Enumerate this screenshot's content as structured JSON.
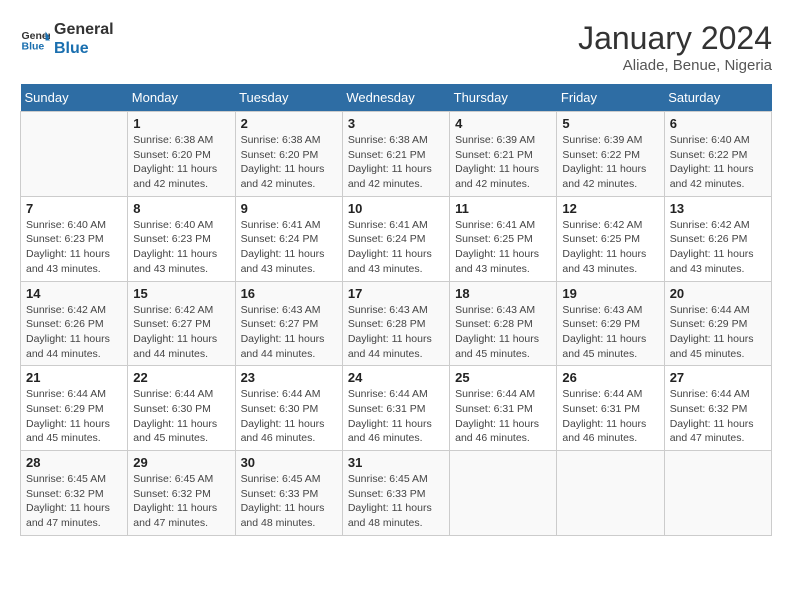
{
  "header": {
    "logo_line1": "General",
    "logo_line2": "Blue",
    "month": "January 2024",
    "location": "Aliade, Benue, Nigeria"
  },
  "days_of_week": [
    "Sunday",
    "Monday",
    "Tuesday",
    "Wednesday",
    "Thursday",
    "Friday",
    "Saturday"
  ],
  "weeks": [
    [
      {
        "day": "",
        "sunrise": "",
        "sunset": "",
        "daylight": ""
      },
      {
        "day": "1",
        "sunrise": "Sunrise: 6:38 AM",
        "sunset": "Sunset: 6:20 PM",
        "daylight": "Daylight: 11 hours and 42 minutes."
      },
      {
        "day": "2",
        "sunrise": "Sunrise: 6:38 AM",
        "sunset": "Sunset: 6:20 PM",
        "daylight": "Daylight: 11 hours and 42 minutes."
      },
      {
        "day": "3",
        "sunrise": "Sunrise: 6:38 AM",
        "sunset": "Sunset: 6:21 PM",
        "daylight": "Daylight: 11 hours and 42 minutes."
      },
      {
        "day": "4",
        "sunrise": "Sunrise: 6:39 AM",
        "sunset": "Sunset: 6:21 PM",
        "daylight": "Daylight: 11 hours and 42 minutes."
      },
      {
        "day": "5",
        "sunrise": "Sunrise: 6:39 AM",
        "sunset": "Sunset: 6:22 PM",
        "daylight": "Daylight: 11 hours and 42 minutes."
      },
      {
        "day": "6",
        "sunrise": "Sunrise: 6:40 AM",
        "sunset": "Sunset: 6:22 PM",
        "daylight": "Daylight: 11 hours and 42 minutes."
      }
    ],
    [
      {
        "day": "7",
        "sunrise": "Sunrise: 6:40 AM",
        "sunset": "Sunset: 6:23 PM",
        "daylight": "Daylight: 11 hours and 43 minutes."
      },
      {
        "day": "8",
        "sunrise": "Sunrise: 6:40 AM",
        "sunset": "Sunset: 6:23 PM",
        "daylight": "Daylight: 11 hours and 43 minutes."
      },
      {
        "day": "9",
        "sunrise": "Sunrise: 6:41 AM",
        "sunset": "Sunset: 6:24 PM",
        "daylight": "Daylight: 11 hours and 43 minutes."
      },
      {
        "day": "10",
        "sunrise": "Sunrise: 6:41 AM",
        "sunset": "Sunset: 6:24 PM",
        "daylight": "Daylight: 11 hours and 43 minutes."
      },
      {
        "day": "11",
        "sunrise": "Sunrise: 6:41 AM",
        "sunset": "Sunset: 6:25 PM",
        "daylight": "Daylight: 11 hours and 43 minutes."
      },
      {
        "day": "12",
        "sunrise": "Sunrise: 6:42 AM",
        "sunset": "Sunset: 6:25 PM",
        "daylight": "Daylight: 11 hours and 43 minutes."
      },
      {
        "day": "13",
        "sunrise": "Sunrise: 6:42 AM",
        "sunset": "Sunset: 6:26 PM",
        "daylight": "Daylight: 11 hours and 43 minutes."
      }
    ],
    [
      {
        "day": "14",
        "sunrise": "Sunrise: 6:42 AM",
        "sunset": "Sunset: 6:26 PM",
        "daylight": "Daylight: 11 hours and 44 minutes."
      },
      {
        "day": "15",
        "sunrise": "Sunrise: 6:42 AM",
        "sunset": "Sunset: 6:27 PM",
        "daylight": "Daylight: 11 hours and 44 minutes."
      },
      {
        "day": "16",
        "sunrise": "Sunrise: 6:43 AM",
        "sunset": "Sunset: 6:27 PM",
        "daylight": "Daylight: 11 hours and 44 minutes."
      },
      {
        "day": "17",
        "sunrise": "Sunrise: 6:43 AM",
        "sunset": "Sunset: 6:28 PM",
        "daylight": "Daylight: 11 hours and 44 minutes."
      },
      {
        "day": "18",
        "sunrise": "Sunrise: 6:43 AM",
        "sunset": "Sunset: 6:28 PM",
        "daylight": "Daylight: 11 hours and 45 minutes."
      },
      {
        "day": "19",
        "sunrise": "Sunrise: 6:43 AM",
        "sunset": "Sunset: 6:29 PM",
        "daylight": "Daylight: 11 hours and 45 minutes."
      },
      {
        "day": "20",
        "sunrise": "Sunrise: 6:44 AM",
        "sunset": "Sunset: 6:29 PM",
        "daylight": "Daylight: 11 hours and 45 minutes."
      }
    ],
    [
      {
        "day": "21",
        "sunrise": "Sunrise: 6:44 AM",
        "sunset": "Sunset: 6:29 PM",
        "daylight": "Daylight: 11 hours and 45 minutes."
      },
      {
        "day": "22",
        "sunrise": "Sunrise: 6:44 AM",
        "sunset": "Sunset: 6:30 PM",
        "daylight": "Daylight: 11 hours and 45 minutes."
      },
      {
        "day": "23",
        "sunrise": "Sunrise: 6:44 AM",
        "sunset": "Sunset: 6:30 PM",
        "daylight": "Daylight: 11 hours and 46 minutes."
      },
      {
        "day": "24",
        "sunrise": "Sunrise: 6:44 AM",
        "sunset": "Sunset: 6:31 PM",
        "daylight": "Daylight: 11 hours and 46 minutes."
      },
      {
        "day": "25",
        "sunrise": "Sunrise: 6:44 AM",
        "sunset": "Sunset: 6:31 PM",
        "daylight": "Daylight: 11 hours and 46 minutes."
      },
      {
        "day": "26",
        "sunrise": "Sunrise: 6:44 AM",
        "sunset": "Sunset: 6:31 PM",
        "daylight": "Daylight: 11 hours and 46 minutes."
      },
      {
        "day": "27",
        "sunrise": "Sunrise: 6:44 AM",
        "sunset": "Sunset: 6:32 PM",
        "daylight": "Daylight: 11 hours and 47 minutes."
      }
    ],
    [
      {
        "day": "28",
        "sunrise": "Sunrise: 6:45 AM",
        "sunset": "Sunset: 6:32 PM",
        "daylight": "Daylight: 11 hours and 47 minutes."
      },
      {
        "day": "29",
        "sunrise": "Sunrise: 6:45 AM",
        "sunset": "Sunset: 6:32 PM",
        "daylight": "Daylight: 11 hours and 47 minutes."
      },
      {
        "day": "30",
        "sunrise": "Sunrise: 6:45 AM",
        "sunset": "Sunset: 6:33 PM",
        "daylight": "Daylight: 11 hours and 48 minutes."
      },
      {
        "day": "31",
        "sunrise": "Sunrise: 6:45 AM",
        "sunset": "Sunset: 6:33 PM",
        "daylight": "Daylight: 11 hours and 48 minutes."
      },
      {
        "day": "",
        "sunrise": "",
        "sunset": "",
        "daylight": ""
      },
      {
        "day": "",
        "sunrise": "",
        "sunset": "",
        "daylight": ""
      },
      {
        "day": "",
        "sunrise": "",
        "sunset": "",
        "daylight": ""
      }
    ]
  ]
}
